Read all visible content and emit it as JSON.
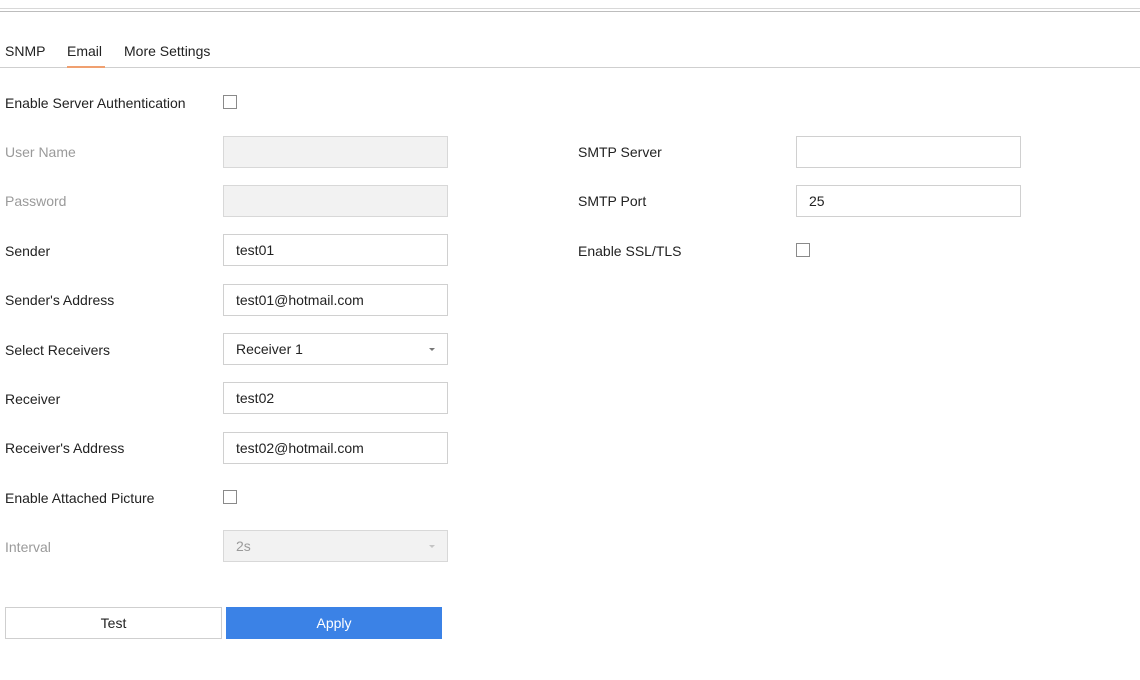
{
  "tabs": [
    {
      "label": "SNMP"
    },
    {
      "label": "Email"
    },
    {
      "label": "More Settings"
    }
  ],
  "active_tab": "Email",
  "form": {
    "enable_server_auth": {
      "label": "Enable Server Authentication",
      "checked": false
    },
    "user_name": {
      "label": "User Name",
      "value": "",
      "disabled": true
    },
    "password": {
      "label": "Password",
      "value": "",
      "disabled": true
    },
    "sender": {
      "label": "Sender",
      "value": "test01"
    },
    "sender_address": {
      "label": "Sender's Address",
      "value": "test01@hotmail.com"
    },
    "select_receivers": {
      "label": "Select Receivers",
      "value": "Receiver 1"
    },
    "receiver": {
      "label": "Receiver",
      "value": "test02"
    },
    "receiver_address": {
      "label": "Receiver's Address",
      "value": "test02@hotmail.com"
    },
    "enable_attached_picture": {
      "label": "Enable Attached Picture",
      "checked": false
    },
    "interval": {
      "label": "Interval",
      "value": "2s",
      "disabled": true
    },
    "smtp_server": {
      "label": "SMTP Server",
      "value": ""
    },
    "smtp_port": {
      "label": "SMTP Port",
      "value": "25"
    },
    "enable_ssl_tls": {
      "label": "Enable SSL/TLS",
      "checked": false
    }
  },
  "buttons": {
    "test": "Test",
    "apply": "Apply"
  },
  "colors": {
    "accent": "#3b82e6",
    "tab_underline": "#f0a070",
    "disabled_text": "#9a9a9a",
    "disabled_field": "#f2f2f2"
  }
}
